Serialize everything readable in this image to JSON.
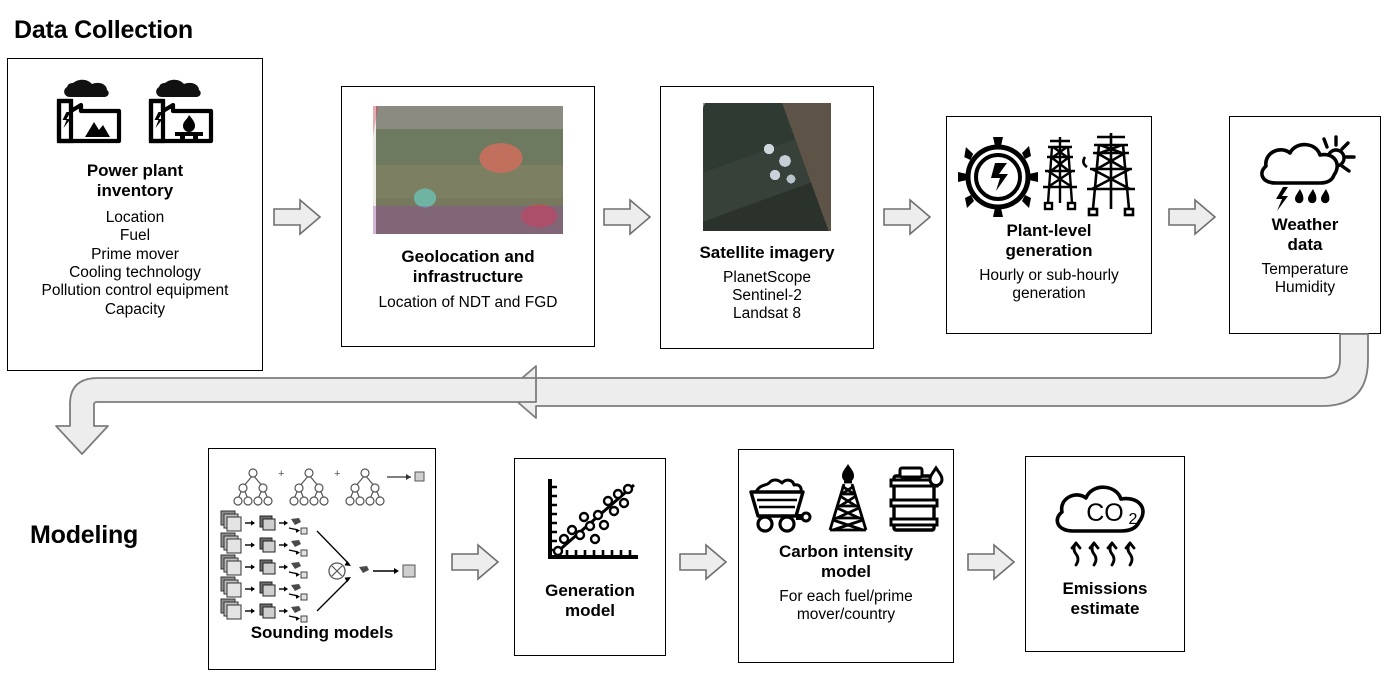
{
  "sections": {
    "data_collection": "Data Collection",
    "modeling": "Modeling"
  },
  "colors": {
    "box_border": "#000000",
    "arrow_fill": "#ededed",
    "arrow_stroke": "#7f7f7f",
    "text": "#000000",
    "background": "#ffffff"
  },
  "row1": [
    {
      "id": "power-plant-inventory",
      "title": "Power plant\ninventory",
      "title_lines": [
        "Power plant",
        "inventory"
      ],
      "details": [
        "Location",
        "Fuel",
        "Prime mover",
        "Cooling technology",
        "Pollution control equipment",
        "Capacity"
      ],
      "icons": [
        "coal-power-plant-icon",
        "gas-power-plant-icon"
      ]
    },
    {
      "id": "geolocation-and-infrastructure",
      "title_lines": [
        "Geolocation and",
        "infrastructure"
      ],
      "details": [
        "Location of NDT and FGD"
      ],
      "icons": [
        "aerial-map-thumbnail"
      ]
    },
    {
      "id": "satellite-imagery",
      "title_lines": [
        "Satellite imagery"
      ],
      "details": [
        "PlanetScope",
        "Sentinel-2",
        "Landsat 8"
      ],
      "icons": [
        "satellite-image-thumbnail"
      ]
    },
    {
      "id": "plant-level-generation",
      "title_lines": [
        "Plant-level",
        "generation"
      ],
      "details": [
        "Hourly or sub-hourly",
        "generation"
      ],
      "icons": [
        "turbine-icon",
        "transmission-tower-icon"
      ]
    },
    {
      "id": "weather-data",
      "title_lines": [
        "Weather",
        "data"
      ],
      "details": [
        "Temperature",
        "Humidity"
      ],
      "icons": [
        "storm-cloud-icon"
      ]
    }
  ],
  "row2": [
    {
      "id": "sounding-models",
      "title_lines": [
        "Sounding models"
      ],
      "details": [],
      "icons": [
        "decision-tree-ensemble-icon",
        "data-pipeline-icon"
      ]
    },
    {
      "id": "generation-model",
      "title_lines": [
        "Generation",
        "model"
      ],
      "details": [],
      "icons": [
        "scatter-regression-icon"
      ]
    },
    {
      "id": "carbon-intensity-model",
      "title_lines": [
        "Carbon intensity",
        "model"
      ],
      "details": [
        "For each fuel/prime",
        "mover/country"
      ],
      "icons": [
        "coal-cart-icon",
        "oil-derrick-icon",
        "oil-barrel-icon"
      ]
    },
    {
      "id": "emissions-estimate",
      "title_lines": [
        "Emissions",
        "estimate"
      ],
      "details": [],
      "icons": [
        "co2-cloud-icon"
      ]
    }
  ],
  "connectors": {
    "row1_arrows": 4,
    "row2_arrows": 3,
    "feedback_label": "",
    "feedback_direction": "right-to-left-then-down"
  }
}
